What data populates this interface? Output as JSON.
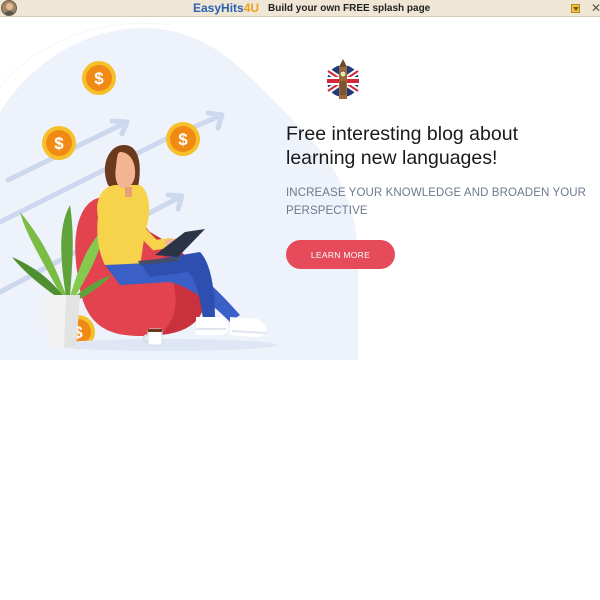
{
  "banner": {
    "brand_main": "EasyHits",
    "brand_accent": "4U",
    "tagline": "Build your own FREE splash page",
    "close_glyph": "✕",
    "brand_color": "#2b64b0",
    "accent_color": "#f0a019"
  },
  "hero": {
    "headline": "Free interesting blog about learning new languages!",
    "subheadline": "INCREASE YOUR KNOWLEDGE AND BROADEN YOUR PERSPECTIVE",
    "cta_label": "LEARN MORE",
    "cta_color": "#e64b5b",
    "coin_symbol": "$",
    "flag_icon": "uk-flag-big-ben-icon"
  }
}
